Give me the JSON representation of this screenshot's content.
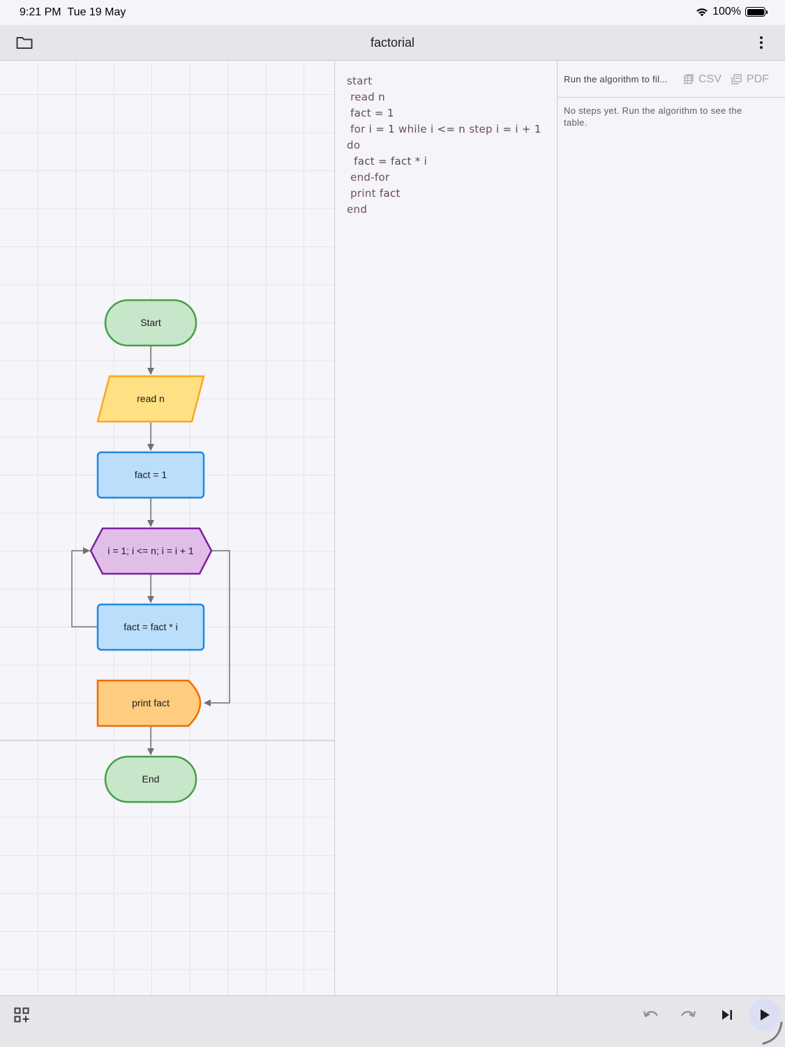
{
  "status_bar": {
    "time": "9:21 PM",
    "date": "Tue 19 May",
    "battery": "100%",
    "battery_level": 1.0
  },
  "app_bar": {
    "title": "factorial",
    "left_icon": "folder-icon",
    "right_icon": "more-vert-icon"
  },
  "flowchart": {
    "nodes": [
      {
        "id": "start",
        "shape": "terminal",
        "label": "Start",
        "fill": "#c8e6c9",
        "stroke": "#43a047"
      },
      {
        "id": "read",
        "shape": "parallelogram",
        "label": "read n",
        "fill": "#ffe082",
        "stroke": "#f9a825"
      },
      {
        "id": "assign1",
        "shape": "rectangle",
        "label": "fact = 1",
        "fill": "#bbdefb",
        "stroke": "#1e88e5"
      },
      {
        "id": "loop",
        "shape": "hexagon",
        "label": "i = 1; i <= n; i = i + 1",
        "fill": "#e1bee7",
        "stroke": "#7b1fa2"
      },
      {
        "id": "assign2",
        "shape": "rectangle",
        "label": "fact = fact * i",
        "fill": "#bbdefb",
        "stroke": "#1e88e5"
      },
      {
        "id": "print",
        "shape": "display",
        "label": "print fact",
        "fill": "#ffcc80",
        "stroke": "#ef6c00"
      },
      {
        "id": "end",
        "shape": "terminal",
        "label": "End",
        "fill": "#c8e6c9",
        "stroke": "#43a047"
      }
    ]
  },
  "code": {
    "lines": [
      {
        "parts": [
          {
            "t": "start",
            "k": true
          }
        ]
      },
      {
        "parts": [
          {
            "t": " read",
            "k": true
          },
          {
            "t": " n",
            "k": false
          }
        ]
      },
      {
        "parts": [
          {
            "t": " fact = 1",
            "k": false
          }
        ]
      },
      {
        "parts": [
          {
            "t": " for",
            "k": true
          },
          {
            "t": " i = 1 ",
            "k": false
          },
          {
            "t": "while",
            "k": true
          },
          {
            "t": " i <= n ",
            "k": false
          },
          {
            "t": "step",
            "k": true
          },
          {
            "t": " i = i + 1",
            "k": false
          }
        ]
      },
      {
        "parts": [
          {
            "t": "do",
            "k": true
          }
        ]
      },
      {
        "parts": [
          {
            "t": "  fact = fact * i",
            "k": false
          }
        ]
      },
      {
        "parts": [
          {
            "t": " end-for",
            "k": true
          }
        ]
      },
      {
        "parts": [
          {
            "t": " print",
            "k": true
          },
          {
            "t": " fact",
            "k": false
          }
        ]
      },
      {
        "parts": [
          {
            "t": "end",
            "k": true
          }
        ]
      }
    ]
  },
  "trace_table": {
    "run_hint": "Run the algorithm to fil...",
    "csv_label": "CSV",
    "pdf_label": "PDF",
    "empty_message": "No steps yet. Run the algorithm to see the table."
  },
  "bottom_bar": {
    "icons": [
      "add-grid-icon",
      "undo-icon",
      "redo-icon",
      "step-forward-icon",
      "play-icon"
    ]
  },
  "colors": {
    "accent_run": "#dcdff3",
    "connector": "#707070",
    "code_keyword": "#6d4a66",
    "code_text": "#5b4557"
  }
}
